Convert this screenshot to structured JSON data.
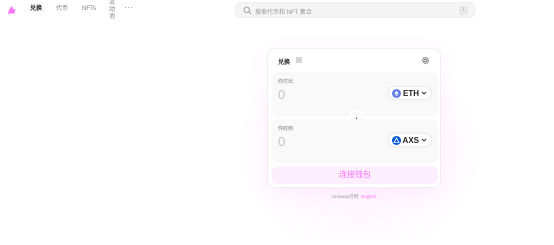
{
  "nav": {
    "logo_icon": "uniswap-unicorn-icon",
    "items": [
      {
        "label": "兑换",
        "active": true
      },
      {
        "label": "代币",
        "active": false
      },
      {
        "label": "NFTs",
        "active": false
      }
    ],
    "stacked_item": [
      "流",
      "动",
      "池"
    ],
    "more_label": "···",
    "search": {
      "placeholder": "搜索代币和 NFT 集合",
      "shortcut": "/"
    }
  },
  "swap": {
    "tab_label": "兑换",
    "sell": {
      "label": "你付出",
      "amount": "0",
      "token": {
        "symbol": "ETH",
        "icon": "eth-icon",
        "color": "#627eea"
      }
    },
    "buy": {
      "label": "你收到",
      "amount": "0",
      "token": {
        "symbol": "AXS",
        "icon": "axs-icon",
        "color": "#0055d5"
      }
    },
    "connect_label": "连接钱包"
  },
  "footer": {
    "text": "Uniswap可用:",
    "lang": "English"
  },
  "colors": {
    "accent": "#fc72ff",
    "accent_soft": "#fdeffe",
    "panel": "#f9f9f9"
  }
}
